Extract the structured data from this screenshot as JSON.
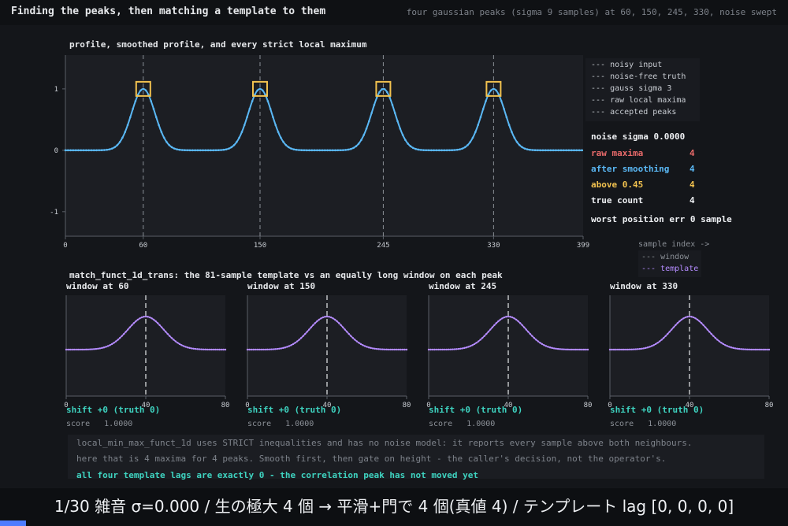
{
  "header": {
    "title": "Finding the peaks, then matching a template to them",
    "subtitle": "four gaussian peaks (sigma 9 samples) at 60, 150, 245, 330, noise swept"
  },
  "top_panel": {
    "title": "profile, smoothed profile, and every strict local maximum",
    "legend": [
      {
        "label": "--- noisy input",
        "color": "#8b9097"
      },
      {
        "label": "--- noise-free truth",
        "color": "#3ed3c0"
      },
      {
        "label": "--- gauss sigma 3",
        "color": "#5ab8f5"
      },
      {
        "label": "--- raw local maxima",
        "color": "#e86a6a"
      },
      {
        "label": "--- accepted peaks",
        "color": "#f2c24f"
      }
    ],
    "stats": {
      "noise": "noise sigma 0.0000",
      "raw_label": "raw maxima",
      "raw_value": "4",
      "smooth_label": "after smoothing",
      "smooth_value": "4",
      "above_label": "above 0.45",
      "above_value": "4",
      "true_label": "true count",
      "true_value": "4",
      "worst": "worst position err 0 sample"
    }
  },
  "bottom": {
    "title": "match_funct_1d_trans: the 81-sample template vs an equally long window on each peak",
    "legend_header": "sample index ->",
    "legend": [
      {
        "label": "--- window",
        "color": "#8b9097"
      },
      {
        "label": "--- template",
        "color": "#b58cff"
      }
    ],
    "windows": [
      {
        "caption": "window at 60",
        "shift": "shift +0  (truth 0)",
        "score": "score   1.0000"
      },
      {
        "caption": "window at 150",
        "shift": "shift +0  (truth 0)",
        "score": "score   1.0000"
      },
      {
        "caption": "window at 245",
        "shift": "shift +0  (truth 0)",
        "score": "score   1.0000"
      },
      {
        "caption": "window at 330",
        "shift": "shift +0  (truth 0)",
        "score": "score   1.0000"
      }
    ]
  },
  "notes": [
    "local_min_max_funct_1d uses STRICT inequalities and has no noise model: it reports every sample above both neighbours.",
    "here that is 4 maxima for 4 peaks. Smooth first, then gate on height - the caller's decision, not the operator's.",
    "all four template lags are exactly 0 - the correlation peak has not moved yet"
  ],
  "footer": {
    "text": "1/30  雑音 σ=0.000  /  生の極大 4 個  →  平滑+門で 4 個(真値 4)  /  テンプレート lag [0, 0, 0, 0]",
    "progress_fraction": 0.0333
  },
  "chart_data": [
    {
      "type": "line",
      "title": "profile, smoothed profile, and every strict local maximum",
      "x_range": [
        0,
        399
      ],
      "xticks": [
        0,
        60,
        150,
        245,
        330,
        399
      ],
      "ylim": [
        -1.4,
        1.55
      ],
      "yticks": [
        -1,
        0,
        1
      ],
      "series": [
        {
          "name": "gauss sigma 3",
          "color": "#5ab8f5",
          "gaussian_peaks": {
            "centers": [
              60,
              150,
              245,
              330
            ],
            "sigma": 9,
            "amplitude": 1.0,
            "n": 400
          }
        }
      ],
      "accepted_peaks": [
        60,
        150,
        245,
        330
      ],
      "grid": "vertical dashed at peaks",
      "legend_position": "right"
    },
    {
      "type": "line",
      "title": "window at 60",
      "x_range": [
        0,
        80
      ],
      "xticks": [
        0,
        40,
        80
      ],
      "series": [
        {
          "name": "template",
          "color": "#b58cff",
          "gaussian": {
            "center": 40,
            "sigma": 9,
            "amplitude": 1.0,
            "n": 81
          }
        }
      ],
      "marker_x": 40
    },
    {
      "type": "line",
      "title": "window at 150",
      "x_range": [
        0,
        80
      ],
      "xticks": [
        0,
        40,
        80
      ],
      "series": [
        {
          "name": "template",
          "color": "#b58cff",
          "gaussian": {
            "center": 40,
            "sigma": 9,
            "amplitude": 1.0,
            "n": 81
          }
        }
      ],
      "marker_x": 40
    },
    {
      "type": "line",
      "title": "window at 245",
      "x_range": [
        0,
        80
      ],
      "xticks": [
        0,
        40,
        80
      ],
      "series": [
        {
          "name": "template",
          "color": "#b58cff",
          "gaussian": {
            "center": 40,
            "sigma": 9,
            "amplitude": 1.0,
            "n": 81
          }
        }
      ],
      "marker_x": 40
    },
    {
      "type": "line",
      "title": "window at 330",
      "x_range": [
        0,
        80
      ],
      "xticks": [
        0,
        40,
        80
      ],
      "series": [
        {
          "name": "template",
          "color": "#b58cff",
          "gaussian": {
            "center": 40,
            "sigma": 9,
            "amplitude": 1.0,
            "n": 81
          }
        }
      ],
      "marker_x": 40
    }
  ]
}
